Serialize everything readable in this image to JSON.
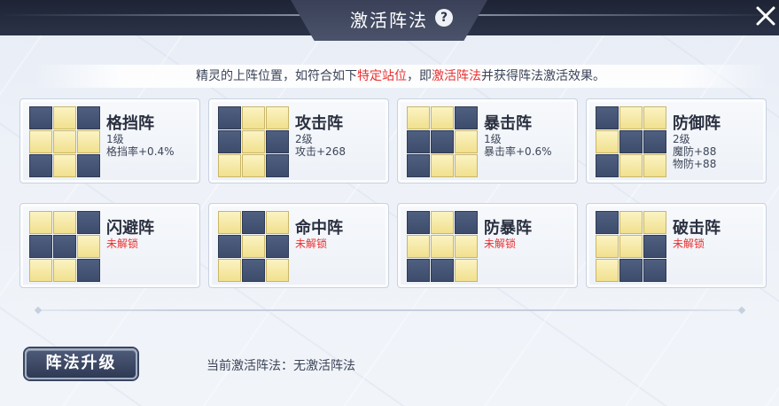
{
  "header": {
    "title": "激活阵法",
    "help_glyph": "?",
    "close_glyph": "✕"
  },
  "info": {
    "text_1": "精灵的上阵位置，如符合如下",
    "highlight_1": "特定站位",
    "text_2": "，即",
    "highlight_2": "激活阵法",
    "text_3": "并获得阵法激活效果。"
  },
  "formations": [
    {
      "name": "格挡阵",
      "lines": [
        "1级",
        "格挡率+0.4%",
        ""
      ],
      "locked": false,
      "pattern": [
        0,
        1,
        0,
        1,
        1,
        1,
        0,
        1,
        0
      ]
    },
    {
      "name": "攻击阵",
      "lines": [
        "2级",
        "攻击+268",
        ""
      ],
      "locked": false,
      "pattern": [
        0,
        1,
        1,
        0,
        1,
        0,
        1,
        1,
        0
      ]
    },
    {
      "name": "暴击阵",
      "lines": [
        "1级",
        "暴击率+0.6%",
        ""
      ],
      "locked": false,
      "pattern": [
        1,
        1,
        0,
        0,
        0,
        1,
        0,
        1,
        1
      ]
    },
    {
      "name": "防御阵",
      "lines": [
        "2级",
        "魔防+88",
        "物防+88"
      ],
      "locked": false,
      "pattern": [
        0,
        1,
        1,
        1,
        0,
        0,
        0,
        1,
        1
      ]
    },
    {
      "name": "闪避阵",
      "lines": [
        "未解锁",
        "",
        ""
      ],
      "locked": true,
      "pattern": [
        1,
        1,
        0,
        0,
        0,
        1,
        1,
        1,
        0
      ]
    },
    {
      "name": "命中阵",
      "lines": [
        "未解锁",
        "",
        ""
      ],
      "locked": true,
      "pattern": [
        1,
        0,
        1,
        0,
        1,
        0,
        1,
        0,
        1
      ]
    },
    {
      "name": "防暴阵",
      "lines": [
        "未解锁",
        "",
        ""
      ],
      "locked": true,
      "pattern": [
        0,
        1,
        0,
        1,
        1,
        1,
        0,
        0,
        1
      ]
    },
    {
      "name": "破击阵",
      "lines": [
        "未解锁",
        "",
        ""
      ],
      "locked": true,
      "pattern": [
        0,
        1,
        1,
        1,
        1,
        0,
        1,
        0,
        0
      ]
    }
  ],
  "footer": {
    "upgrade_label": "阵法升级",
    "status_label": "当前激活阵法：",
    "status_value": "无激活阵法"
  },
  "colors": {
    "highlight_red": "#ea2f2f",
    "tile_active": "#f1e08e",
    "tile_inactive": "#3d4c6b",
    "header_dark": "#1e2435"
  }
}
